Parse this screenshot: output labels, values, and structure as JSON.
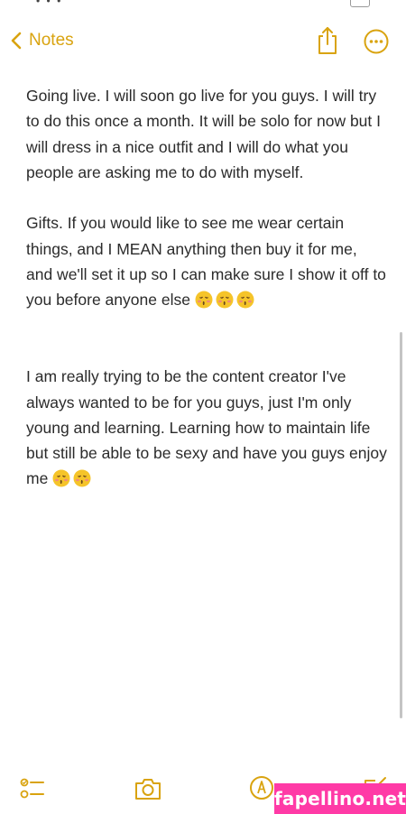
{
  "nav": {
    "back_label": "Notes",
    "accent_color": "#d9a30f",
    "icons": {
      "back": "chevron-left-icon",
      "share": "share-icon",
      "more": "more-ellipsis-icon"
    }
  },
  "note": {
    "paragraphs": [
      {
        "text": "Going live. I will soon go live for you guys. I will try to do this once a month. It will be solo for now but I will dress in a nice outfit and I will do what you people are asking me to do with myself.",
        "emoji_count": 0
      },
      {
        "text": "Gifts. If you would like to see me wear certain things, and I MEAN anything then buy it for me, and we'll set it up so I can make sure I show it off to you before anyone else",
        "emoji_count": 3
      },
      {
        "text": "I am really trying to be the content creator I've always wanted to be for you guys, just I'm only young and learning. Learning how to maintain life but still be able to be sexy and have you guys enjoy me",
        "emoji_count": 2
      }
    ],
    "emoji": "kissing-face-emoji",
    "text_color": "#2b2b2b"
  },
  "toolbar": {
    "icons": [
      "checklist-icon",
      "camera-icon",
      "markup-pen-icon",
      "compose-icon"
    ]
  },
  "watermark": {
    "text": "fapellino.net",
    "color": "#ff3aa6"
  }
}
